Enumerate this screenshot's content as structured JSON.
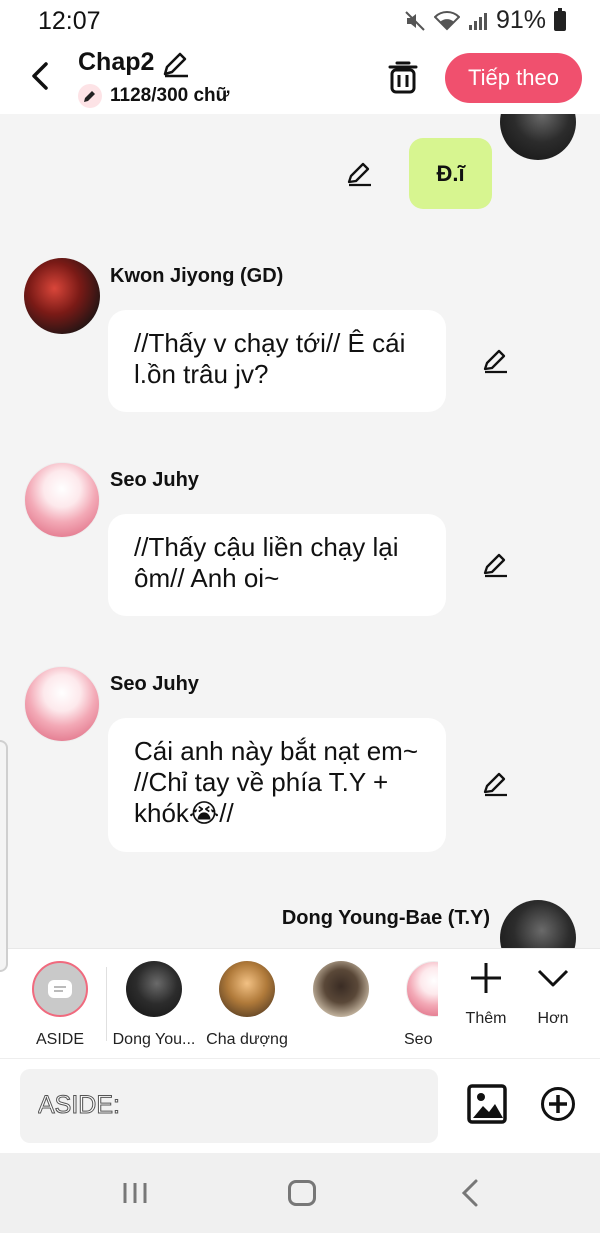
{
  "status_bar": {
    "time": "12:07",
    "battery": "91%"
  },
  "header": {
    "title": "Chap2",
    "word_count": "1128/300 chữ",
    "next_button": "Tiếp theo"
  },
  "messages": [
    {
      "type": "right",
      "text": "Đ.ĩ"
    },
    {
      "type": "left",
      "sender": "Kwon Jiyong (GD)",
      "text": "//Thấy v chạy tới// Ê cái l.ồn trâu jv?"
    },
    {
      "type": "left",
      "sender": "Seo Juhy",
      "text": "//Thấy cậu liền chạy lại ôm// Anh oi~"
    },
    {
      "type": "left",
      "sender": "Seo Juhy",
      "text": "Cái anh này bắt nạt em~ //Chỉ tay về phía T.Y + khók😭//"
    },
    {
      "type": "right",
      "sender": "Dong Young-Bae (T.Y)"
    }
  ],
  "characters": [
    {
      "label": "ASIDE"
    },
    {
      "label": "Dong You..."
    },
    {
      "label": "Cha dượng"
    },
    {
      "label": ""
    },
    {
      "label": "Seo"
    }
  ],
  "selector_actions": {
    "more": "Thêm",
    "less": "Hơn"
  },
  "input": {
    "placeholder": "ASIDE:"
  },
  "icons": {
    "back": "chevron-left-icon",
    "edit": "pencil-icon",
    "trash": "trash-icon",
    "image": "image-icon",
    "add": "plus-circle-icon"
  },
  "colors": {
    "accent": "#f0506e",
    "green_bubble": "#d7f590"
  }
}
